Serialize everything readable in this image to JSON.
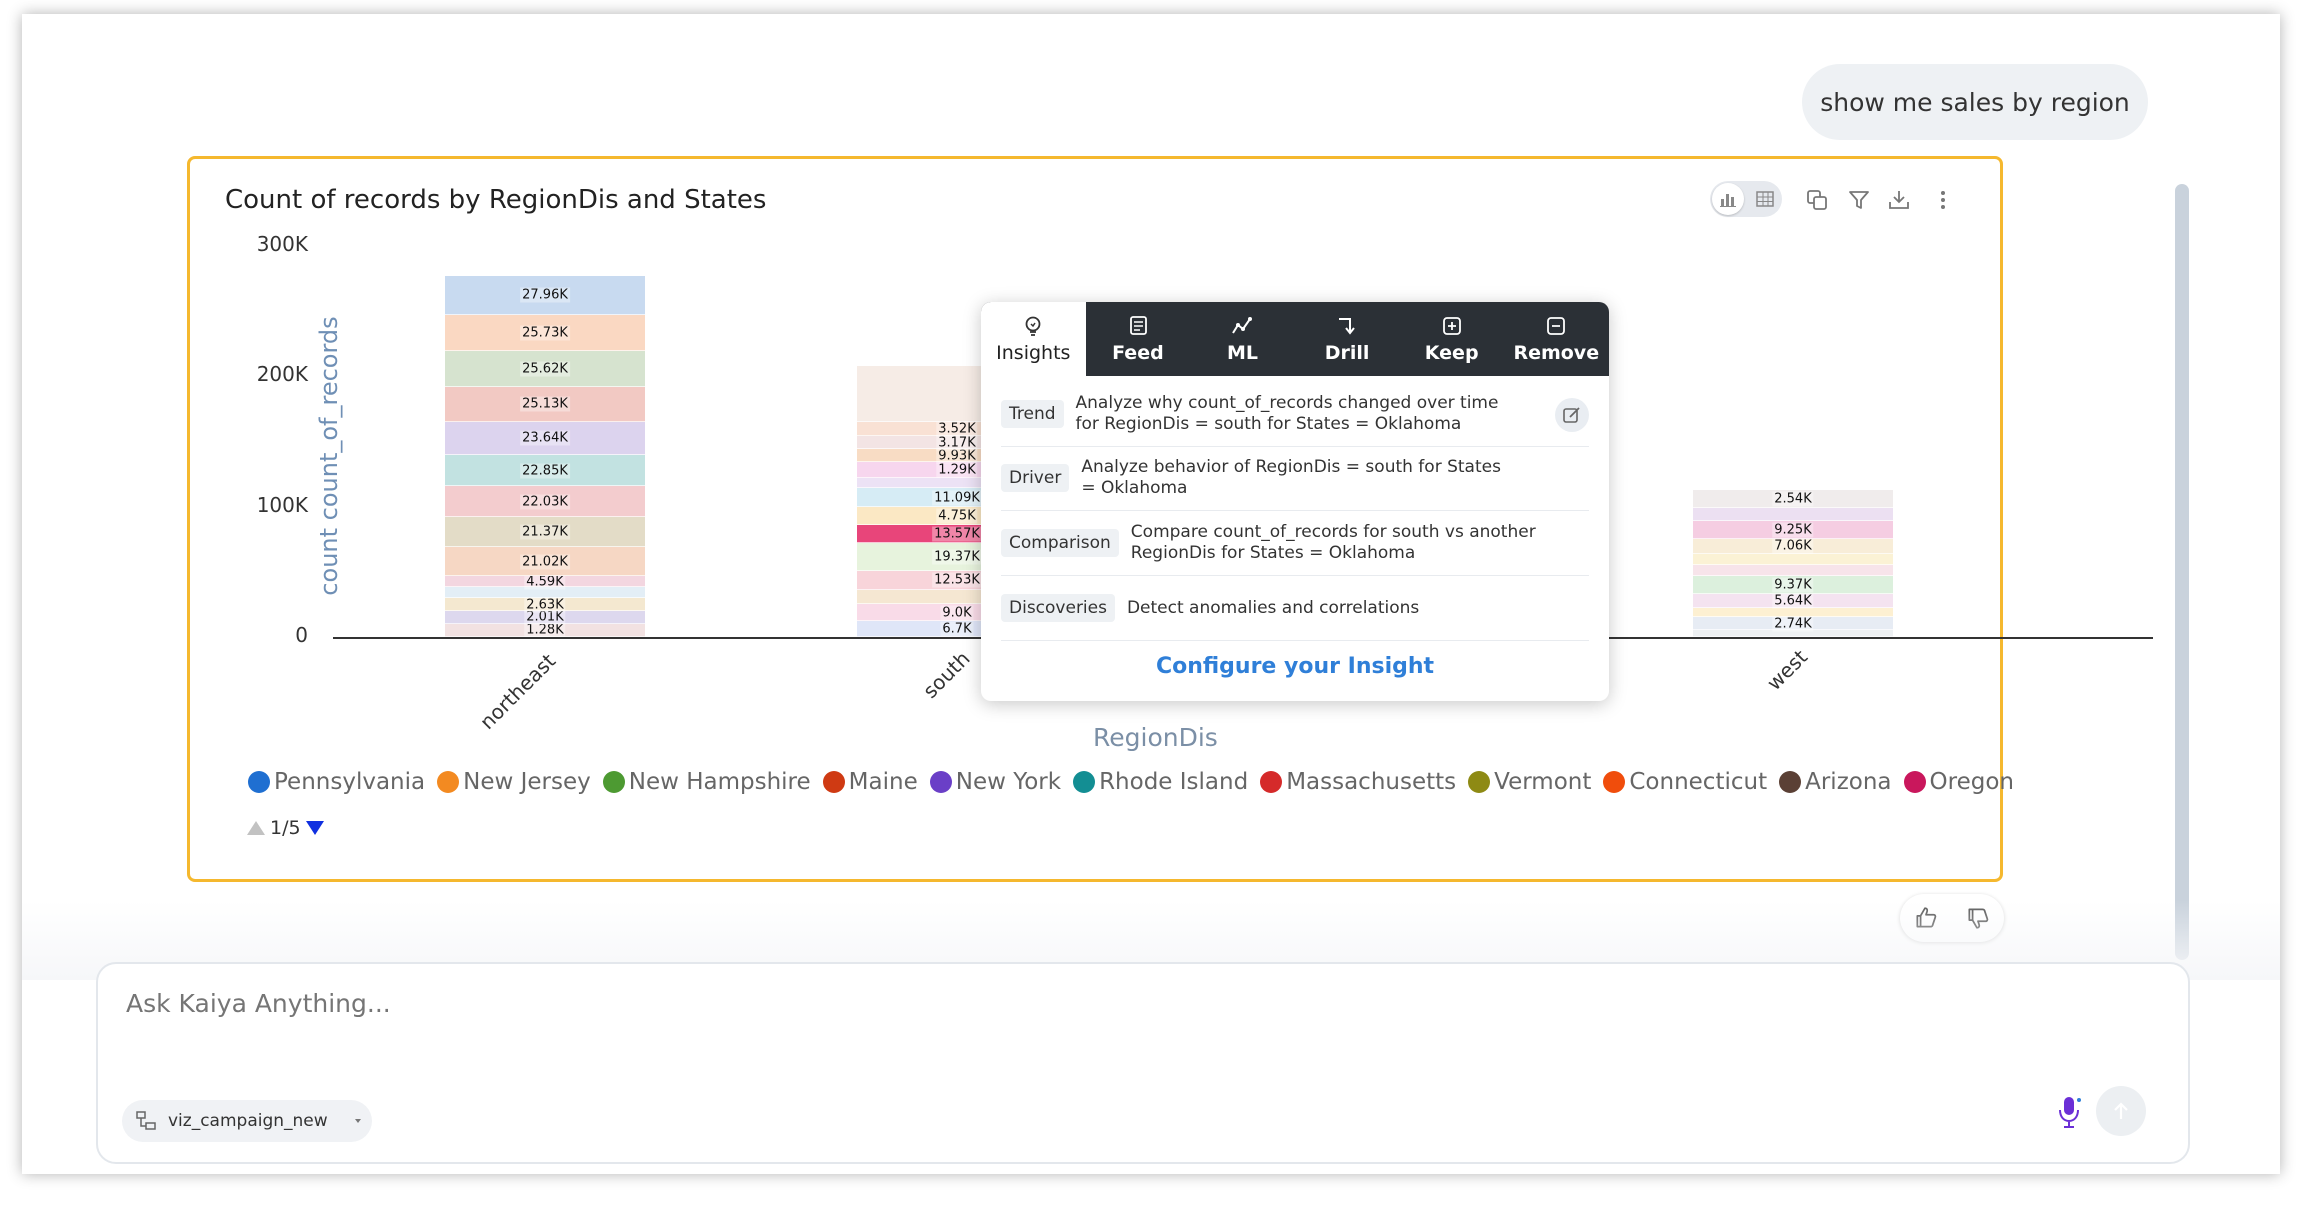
{
  "conversation": {
    "user_message": "show me sales by region"
  },
  "card": {
    "title": "Count of records by RegionDis and States"
  },
  "chart_data": {
    "type": "bar",
    "stacked": true,
    "title": "Count of records by RegionDis and States",
    "xlabel": "RegionDis",
    "ylabel": "count count_of_records",
    "categories": [
      "northeast",
      "south",
      "west"
    ],
    "ylim": [
      0,
      300000
    ],
    "y_ticks": [
      {
        "value": 0,
        "label": "0"
      },
      {
        "value": 100000,
        "label": "100K"
      },
      {
        "value": 200000,
        "label": "200K"
      },
      {
        "value": 300000,
        "label": "300K"
      }
    ],
    "grid": false,
    "legend_position": "bottom-left",
    "stacks": [
      {
        "category": "northeast",
        "total": 277000,
        "segments": [
          {
            "label": "1.28K",
            "value": 9500,
            "color": "#f2e2e2"
          },
          {
            "label": "2.01K",
            "value": 9000,
            "color": "#ddd8ee"
          },
          {
            "label": "2.63K",
            "value": 9500,
            "color": "#f4e8d0"
          },
          {
            "label": "",
            "value": 8000,
            "color": "#e3eef6"
          },
          {
            "label": "4.59K",
            "value": 7500,
            "color": "#f3d6e0"
          },
          {
            "label": "21.02K",
            "value": 21020,
            "color": "#f6d7c4"
          },
          {
            "label": "21.37K",
            "value": 21370,
            "color": "#e3dcc7"
          },
          {
            "label": "22.03K",
            "value": 22030,
            "color": "#f3ccce"
          },
          {
            "label": "22.85K",
            "value": 22850,
            "color": "#c2e2e1"
          },
          {
            "label": "23.64K",
            "value": 23640,
            "color": "#dcd3ee"
          },
          {
            "label": "25.13K",
            "value": 25130,
            "color": "#f2c9c3"
          },
          {
            "label": "25.62K",
            "value": 25620,
            "color": "#d6e3cf"
          },
          {
            "label": "25.73K",
            "value": 25730,
            "color": "#fad8c2"
          },
          {
            "label": "27.96K",
            "value": 27960,
            "color": "#c8daf0"
          }
        ]
      },
      {
        "category": "south",
        "total": 208000,
        "segments": [
          {
            "label": "6.7K",
            "value": 12000,
            "color": "#dfe6f8"
          },
          {
            "label": "9.0K",
            "value": 13000,
            "color": "#f9dbe8"
          },
          {
            "label": "",
            "value": 11000,
            "color": "#f5e7d2"
          },
          {
            "label": "12.53K",
            "value": 15000,
            "color": "#f8d4da"
          },
          {
            "label": "19.37K",
            "value": 21000,
            "color": "#e7f3dd"
          },
          {
            "label": "13.57K",
            "value": 14000,
            "color": "#e8457a"
          },
          {
            "label": "4.75K",
            "value": 14000,
            "color": "#fbe8c4"
          },
          {
            "label": "11.09K",
            "value": 14000,
            "color": "#d6ecf5"
          },
          {
            "label": "",
            "value": 8000,
            "color": "#ece2f5"
          },
          {
            "label": "1.29K",
            "value": 12000,
            "color": "#f7d6ee"
          },
          {
            "label": "9.93K",
            "value": 10000,
            "color": "#f8dcc4"
          },
          {
            "label": "3.17K",
            "value": 10000,
            "color": "#f3e4e4"
          },
          {
            "label": "3.52K",
            "value": 11000,
            "color": "#f9e1d4"
          },
          {
            "label": "",
            "value": 43000,
            "color": "#f6ece6"
          }
        ]
      },
      {
        "category": "west",
        "total": 113000,
        "segments": [
          {
            "label": "",
            "value": 5000,
            "color": "#eef1f3"
          },
          {
            "label": "2.74K",
            "value": 10000,
            "color": "#e7ecf4"
          },
          {
            "label": "",
            "value": 7000,
            "color": "#fdf0d2"
          },
          {
            "label": "5.64K",
            "value": 11000,
            "color": "#f4e3f0"
          },
          {
            "label": "9.37K",
            "value": 14000,
            "color": "#dcf0dd"
          },
          {
            "label": "",
            "value": 8000,
            "color": "#f7e4ea"
          },
          {
            "label": "",
            "value": 9000,
            "color": "#fbf2d5"
          },
          {
            "label": "7.06K",
            "value": 11000,
            "color": "#f8edd8"
          },
          {
            "label": "9.25K",
            "value": 14000,
            "color": "#f5cde2"
          },
          {
            "label": "",
            "value": 10000,
            "color": "#ece0f2"
          },
          {
            "label": "2.54K",
            "value": 14000,
            "color": "#f0ecec"
          }
        ]
      }
    ],
    "legend": [
      {
        "name": "Pennsylvania",
        "color": "#1f6fd1"
      },
      {
        "name": "New Jersey",
        "color": "#f38a21"
      },
      {
        "name": "New Hampshire",
        "color": "#4d9a32"
      },
      {
        "name": "Maine",
        "color": "#cf3a13"
      },
      {
        "name": "New York",
        "color": "#6a3fc7"
      },
      {
        "name": "Rhode Island",
        "color": "#138e93"
      },
      {
        "name": "Massachusetts",
        "color": "#d52a2a"
      },
      {
        "name": "Vermont",
        "color": "#8e8a14"
      },
      {
        "name": "Connecticut",
        "color": "#f04d0c"
      },
      {
        "name": "Arizona",
        "color": "#5b4035"
      },
      {
        "name": "Oregon",
        "color": "#c9175c"
      }
    ]
  },
  "pager": {
    "label": "1/5"
  },
  "popover": {
    "tabs": [
      {
        "label": "Insights",
        "icon": "lightbulb-icon"
      },
      {
        "label": "Feed",
        "icon": "feed-icon"
      },
      {
        "label": "ML",
        "icon": "ml-icon"
      },
      {
        "label": "Drill",
        "icon": "drill-icon"
      },
      {
        "label": "Keep",
        "icon": "keep-icon"
      },
      {
        "label": "Remove",
        "icon": "remove-icon"
      }
    ],
    "rows": [
      {
        "tag": "Trend",
        "text": "Analyze why count_of_records changed over time for RegionDis = south for States = Oklahoma"
      },
      {
        "tag": "Driver",
        "text": "Analyze behavior of RegionDis = south for States = Oklahoma"
      },
      {
        "tag": "Comparison",
        "text": "Compare count_of_records for south vs another RegionDis for States = Oklahoma"
      },
      {
        "tag": "Discoveries",
        "text": "Detect anomalies and correlations"
      }
    ],
    "configure_link": "Configure your Insight"
  },
  "input": {
    "placeholder": "Ask Kaiya Anything...",
    "dataset_chip": "viz_campaign_new"
  },
  "colors": {
    "card_border": "#f5b82e",
    "link": "#2f7fd8",
    "popover_header": "#2b3036",
    "axis_title": "#6f8fb5"
  }
}
